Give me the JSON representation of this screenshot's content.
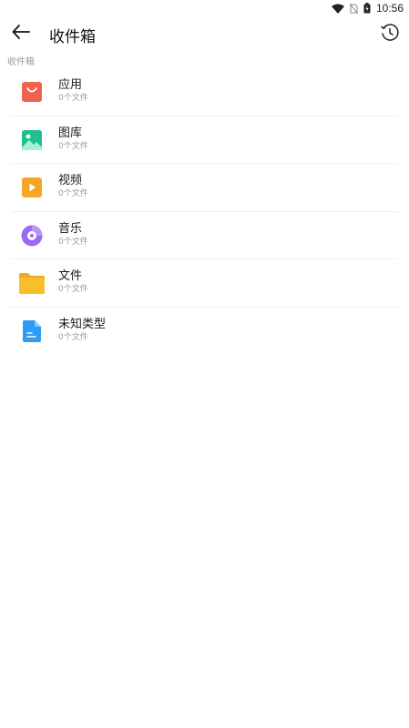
{
  "status_bar": {
    "time": "10:56",
    "icons": [
      "wifi-icon",
      "no-sim-icon",
      "battery-charging-icon"
    ]
  },
  "app_bar": {
    "title": "收件箱",
    "back_icon": "arrow-left-icon",
    "history_icon": "clock-history-icon"
  },
  "section_label": "收件箱",
  "categories": [
    {
      "name": "应用",
      "count": "0个文件",
      "icon": "app-bag-icon",
      "color": "#F0624F"
    },
    {
      "name": "图库",
      "count": "0个文件",
      "icon": "gallery-icon",
      "color": "#1FBF8F"
    },
    {
      "name": "视频",
      "count": "0个文件",
      "icon": "video-icon",
      "color": "#F5A623"
    },
    {
      "name": "音乐",
      "count": "0个文件",
      "icon": "music-icon",
      "color": "#9A6BF2"
    },
    {
      "name": "文件",
      "count": "0个文件",
      "icon": "folder-icon",
      "color": "#F9BE2C"
    },
    {
      "name": "未知类型",
      "count": "0个文件",
      "icon": "unknown-file-icon",
      "color": "#2E9BF5"
    }
  ]
}
